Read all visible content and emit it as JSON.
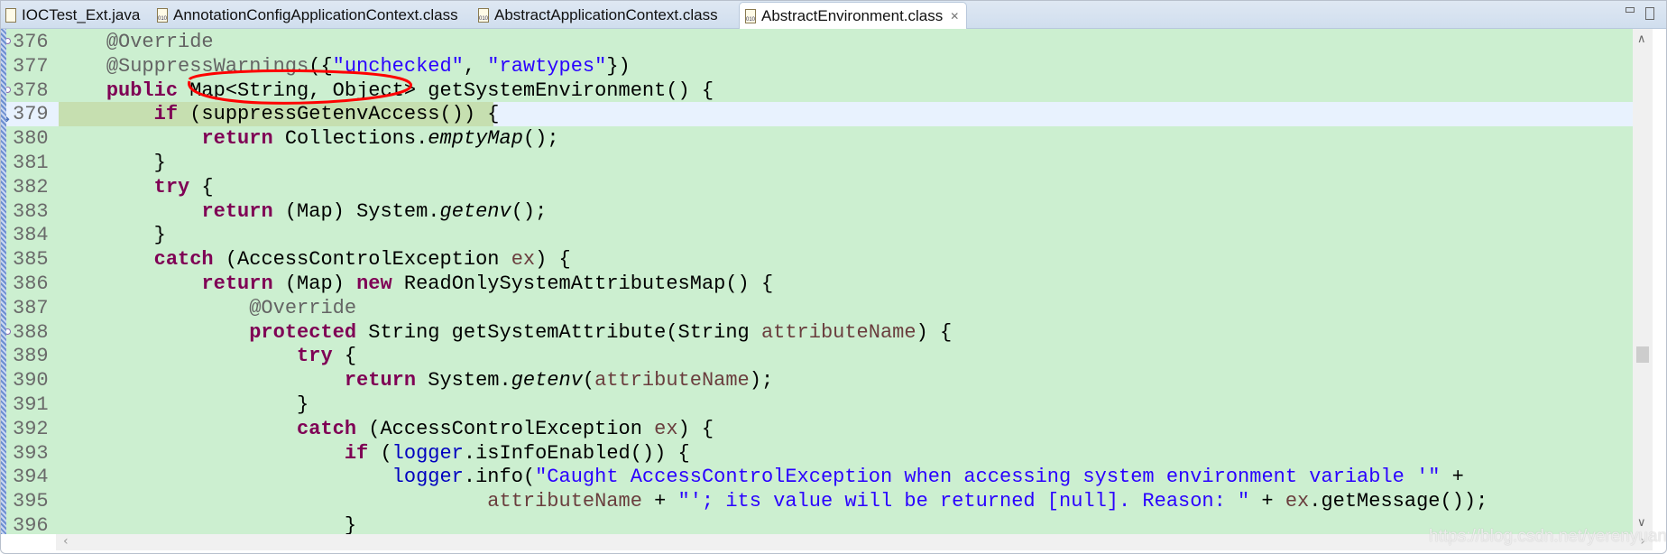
{
  "tabs": [
    {
      "label": "IOCTest_Ext.java",
      "icon": "java-file-icon",
      "active": false
    },
    {
      "label": "AnnotationConfigApplicationContext.class",
      "icon": "class-file-icon",
      "active": false
    },
    {
      "label": "AbstractApplicationContext.class",
      "icon": "class-file-icon",
      "active": false
    },
    {
      "label": "AbstractEnvironment.class",
      "icon": "class-file-icon",
      "active": true
    }
  ],
  "colors": {
    "editor_bg": "#ccefd0",
    "current_line": "#e8f2fe",
    "keyword": "#7f0055",
    "string": "#2a00ff",
    "field": "#0000c0",
    "param": "#6a3e3e",
    "annotation": "#646464",
    "annotation_mark": "#ff0000"
  },
  "current_line": 379,
  "lines": [
    {
      "num": "376",
      "fold": true,
      "tokens": [
        [
          "    ",
          ""
        ],
        [
          "@Override",
          "a"
        ]
      ]
    },
    {
      "num": "377",
      "tokens": [
        [
          "    ",
          ""
        ],
        [
          "@SuppressWarnings",
          "a"
        ],
        [
          "({",
          ""
        ],
        [
          "\"unchecked\"",
          "s"
        ],
        [
          ", ",
          ""
        ],
        [
          "\"rawtypes\"",
          "s"
        ],
        [
          "})",
          ""
        ]
      ]
    },
    {
      "num": "378",
      "fold": true,
      "tokens": [
        [
          "    ",
          ""
        ],
        [
          "public",
          "k"
        ],
        [
          " Map<String, Object> getSystemEnvironment() {",
          ""
        ]
      ]
    },
    {
      "num": "379",
      "current": true,
      "tokens": [
        [
          "        ",
          ""
        ],
        [
          "if",
          "k"
        ],
        [
          " (suppressGetenvAccess()) {",
          ""
        ]
      ]
    },
    {
      "num": "380",
      "tokens": [
        [
          "            ",
          ""
        ],
        [
          "return",
          "k"
        ],
        [
          " Collections.",
          ""
        ],
        [
          "emptyMap",
          "i"
        ],
        [
          "();",
          ""
        ]
      ]
    },
    {
      "num": "381",
      "tokens": [
        [
          "        }",
          ""
        ]
      ]
    },
    {
      "num": "382",
      "tokens": [
        [
          "        ",
          ""
        ],
        [
          "try",
          "k"
        ],
        [
          " {",
          ""
        ]
      ]
    },
    {
      "num": "383",
      "tokens": [
        [
          "            ",
          ""
        ],
        [
          "return",
          "k"
        ],
        [
          " (Map) System.",
          ""
        ],
        [
          "getenv",
          "i"
        ],
        [
          "();",
          ""
        ]
      ]
    },
    {
      "num": "384",
      "tokens": [
        [
          "        }",
          ""
        ]
      ]
    },
    {
      "num": "385",
      "tokens": [
        [
          "        ",
          ""
        ],
        [
          "catch",
          "k"
        ],
        [
          " (AccessControlException ",
          ""
        ],
        [
          "ex",
          "p"
        ],
        [
          ") {",
          ""
        ]
      ]
    },
    {
      "num": "386",
      "tokens": [
        [
          "            ",
          ""
        ],
        [
          "return",
          "k"
        ],
        [
          " (Map) ",
          ""
        ],
        [
          "new",
          "k"
        ],
        [
          " ReadOnlySystemAttributesMap() {",
          ""
        ]
      ]
    },
    {
      "num": "387",
      "tokens": [
        [
          "                ",
          ""
        ],
        [
          "@Override",
          "a"
        ]
      ]
    },
    {
      "num": "388",
      "fold": true,
      "tokens": [
        [
          "                ",
          ""
        ],
        [
          "protected",
          "k"
        ],
        [
          " String getSystemAttribute(String ",
          ""
        ],
        [
          "attributeName",
          "p"
        ],
        [
          ") {",
          ""
        ]
      ]
    },
    {
      "num": "389",
      "tokens": [
        [
          "                    ",
          ""
        ],
        [
          "try",
          "k"
        ],
        [
          " {",
          ""
        ]
      ]
    },
    {
      "num": "390",
      "tokens": [
        [
          "                        ",
          ""
        ],
        [
          "return",
          "k"
        ],
        [
          " System.",
          ""
        ],
        [
          "getenv",
          "i"
        ],
        [
          "(",
          ""
        ],
        [
          "attributeName",
          "p"
        ],
        [
          ");",
          ""
        ]
      ]
    },
    {
      "num": "391",
      "tokens": [
        [
          "                    }",
          ""
        ]
      ]
    },
    {
      "num": "392",
      "tokens": [
        [
          "                    ",
          ""
        ],
        [
          "catch",
          "k"
        ],
        [
          " (AccessControlException ",
          ""
        ],
        [
          "ex",
          "p"
        ],
        [
          ") {",
          ""
        ]
      ]
    },
    {
      "num": "393",
      "tokens": [
        [
          "                        ",
          ""
        ],
        [
          "if",
          "k"
        ],
        [
          " (",
          ""
        ],
        [
          "logger",
          "f"
        ],
        [
          ".isInfoEnabled()) {",
          ""
        ]
      ]
    },
    {
      "num": "394",
      "tokens": [
        [
          "                            ",
          ""
        ],
        [
          "logger",
          "f"
        ],
        [
          ".info(",
          ""
        ],
        [
          "\"Caught AccessControlException when accessing system environment variable '\"",
          "s"
        ],
        [
          " +",
          ""
        ]
      ]
    },
    {
      "num": "395",
      "tokens": [
        [
          "                                    ",
          ""
        ],
        [
          "attributeName",
          "p"
        ],
        [
          " + ",
          ""
        ],
        [
          "\"'; its value will be returned [null]. Reason: \"",
          "s"
        ],
        [
          " + ",
          ""
        ],
        [
          "ex",
          "p"
        ],
        [
          ".getMessage());",
          ""
        ]
      ]
    },
    {
      "num": "396",
      "tokens": [
        [
          "                        }",
          ""
        ]
      ]
    }
  ],
  "watermark": "https://blog.csdn.net/yerenyuan_pku"
}
